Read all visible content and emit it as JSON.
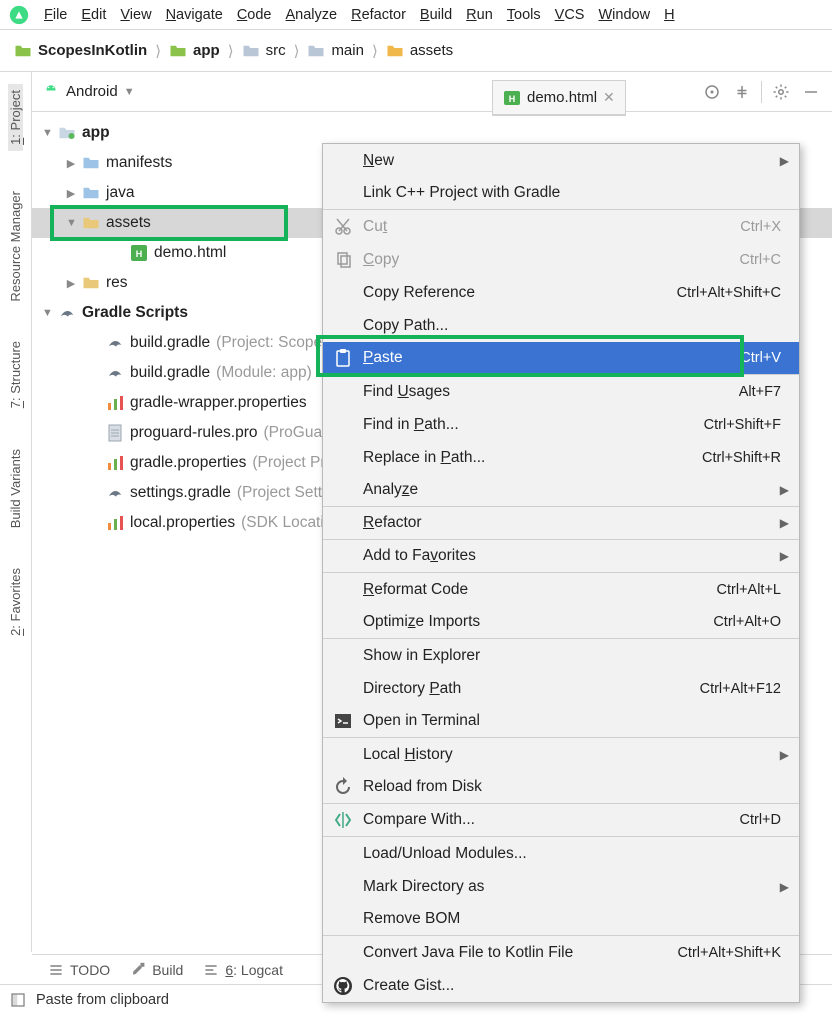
{
  "menubar": [
    "File",
    "Edit",
    "View",
    "Navigate",
    "Code",
    "Analyze",
    "Refactor",
    "Build",
    "Run",
    "Tools",
    "VCS",
    "Window",
    "H"
  ],
  "breadcrumbs": [
    {
      "label": "ScopesInKotlin",
      "bold": true,
      "icon": "project"
    },
    {
      "label": "app",
      "bold": true,
      "icon": "module"
    },
    {
      "label": "src",
      "bold": false,
      "icon": "folder"
    },
    {
      "label": "main",
      "bold": false,
      "icon": "folder"
    },
    {
      "label": "assets",
      "bold": false,
      "icon": "assets"
    }
  ],
  "panel": {
    "mode": "Android",
    "tree": [
      {
        "level": 0,
        "arrow": "down",
        "icon": "module",
        "label": "app",
        "sub": "",
        "selected": false
      },
      {
        "level": 1,
        "arrow": "right",
        "icon": "folder",
        "label": "manifests",
        "sub": "",
        "selected": false
      },
      {
        "level": 1,
        "arrow": "right",
        "icon": "folder",
        "label": "java",
        "sub": "",
        "selected": false
      },
      {
        "level": 1,
        "arrow": "down",
        "icon": "assets",
        "label": "assets",
        "sub": "",
        "selected": true
      },
      {
        "level": 3,
        "arrow": "",
        "icon": "html",
        "label": "demo.html",
        "sub": "",
        "selected": false
      },
      {
        "level": 1,
        "arrow": "right",
        "icon": "res",
        "label": "res",
        "sub": "",
        "selected": false
      },
      {
        "level": 0,
        "arrow": "down",
        "icon": "gradle",
        "label": "Gradle Scripts",
        "sub": "",
        "selected": false
      },
      {
        "level": 2,
        "arrow": "",
        "icon": "gradle",
        "label": "build.gradle ",
        "sub": "(Project: ScopesInKotlin)",
        "selected": false
      },
      {
        "level": 2,
        "arrow": "",
        "icon": "gradle",
        "label": "build.gradle ",
        "sub": "(Module: app)",
        "selected": false
      },
      {
        "level": 2,
        "arrow": "",
        "icon": "props",
        "label": "gradle-wrapper.properties ",
        "sub": "",
        "selected": false
      },
      {
        "level": 2,
        "arrow": "",
        "icon": "file",
        "label": "proguard-rules.pro ",
        "sub": "(ProGuard)",
        "selected": false
      },
      {
        "level": 2,
        "arrow": "",
        "icon": "props",
        "label": "gradle.properties ",
        "sub": "(Project Properties)",
        "selected": false
      },
      {
        "level": 2,
        "arrow": "",
        "icon": "gradle",
        "label": "settings.gradle ",
        "sub": "(Project Settings)",
        "selected": false
      },
      {
        "level": 2,
        "arrow": "",
        "icon": "props",
        "label": "local.properties ",
        "sub": "(SDK Location)",
        "selected": false
      }
    ]
  },
  "editor_tab": {
    "label": "demo.html"
  },
  "gutter": [
    {
      "label": "1: Project",
      "icon": "project",
      "active": true
    },
    {
      "label": "Resource Manager",
      "icon": "resource",
      "active": false
    },
    {
      "label": "7: Structure",
      "icon": "structure",
      "active": false
    },
    {
      "label": "Build Variants",
      "icon": "variants",
      "active": false
    },
    {
      "label": "2: Favorites",
      "icon": "star",
      "active": false
    }
  ],
  "context_menu": [
    {
      "icon": "",
      "label": "New",
      "shortcut": "",
      "expand": true,
      "sep": false,
      "key": "N"
    },
    {
      "icon": "",
      "label": "Link C++ Project with Gradle",
      "shortcut": "",
      "expand": false,
      "sep": true,
      "key": ""
    },
    {
      "icon": "cut",
      "label": "Cut",
      "shortcut": "Ctrl+X",
      "expand": false,
      "sep": false,
      "disabled": true,
      "key": "t"
    },
    {
      "icon": "copy",
      "label": "Copy",
      "shortcut": "Ctrl+C",
      "expand": false,
      "sep": false,
      "disabled": true,
      "key": "C"
    },
    {
      "icon": "",
      "label": "Copy Reference",
      "shortcut": "Ctrl+Alt+Shift+C",
      "expand": false,
      "sep": false,
      "key": ""
    },
    {
      "icon": "",
      "label": "Copy Path...",
      "shortcut": "",
      "expand": false,
      "sep": false,
      "key": ""
    },
    {
      "icon": "paste",
      "label": "Paste",
      "shortcut": "Ctrl+V",
      "expand": false,
      "sep": true,
      "highlight": true,
      "key": "P"
    },
    {
      "icon": "",
      "label": "Find Usages",
      "shortcut": "Alt+F7",
      "expand": false,
      "sep": false,
      "key": "U"
    },
    {
      "icon": "",
      "label": "Find in Path...",
      "shortcut": "Ctrl+Shift+F",
      "expand": false,
      "sep": false,
      "key": "P"
    },
    {
      "icon": "",
      "label": "Replace in Path...",
      "shortcut": "Ctrl+Shift+R",
      "expand": false,
      "sep": false,
      "key": "P"
    },
    {
      "icon": "",
      "label": "Analyze",
      "shortcut": "",
      "expand": true,
      "sep": true,
      "key": "z"
    },
    {
      "icon": "",
      "label": "Refactor",
      "shortcut": "",
      "expand": true,
      "sep": true,
      "key": "R"
    },
    {
      "icon": "",
      "label": "Add to Favorites",
      "shortcut": "",
      "expand": true,
      "sep": true,
      "key": "v"
    },
    {
      "icon": "",
      "label": "Reformat Code",
      "shortcut": "Ctrl+Alt+L",
      "expand": false,
      "sep": false,
      "key": "R"
    },
    {
      "icon": "",
      "label": "Optimize Imports",
      "shortcut": "Ctrl+Alt+O",
      "expand": false,
      "sep": true,
      "key": "z"
    },
    {
      "icon": "",
      "label": "Show in Explorer",
      "shortcut": "",
      "expand": false,
      "sep": false,
      "key": ""
    },
    {
      "icon": "",
      "label": "Directory Path",
      "shortcut": "Ctrl+Alt+F12",
      "expand": false,
      "sep": false,
      "key": "P"
    },
    {
      "icon": "terminal",
      "label": "Open in Terminal",
      "shortcut": "",
      "expand": false,
      "sep": true,
      "key": ""
    },
    {
      "icon": "",
      "label": "Local History",
      "shortcut": "",
      "expand": true,
      "sep": false,
      "key": "H"
    },
    {
      "icon": "reload",
      "label": "Reload from Disk",
      "shortcut": "",
      "expand": false,
      "sep": true,
      "key": ""
    },
    {
      "icon": "compare",
      "label": "Compare With...",
      "shortcut": "Ctrl+D",
      "expand": false,
      "sep": true,
      "key": ""
    },
    {
      "icon": "",
      "label": "Load/Unload Modules...",
      "shortcut": "",
      "expand": false,
      "sep": false,
      "key": ""
    },
    {
      "icon": "",
      "label": "Mark Directory as",
      "shortcut": "",
      "expand": true,
      "sep": false,
      "key": ""
    },
    {
      "icon": "",
      "label": "Remove BOM",
      "shortcut": "",
      "expand": false,
      "sep": true,
      "key": ""
    },
    {
      "icon": "",
      "label": "Convert Java File to Kotlin File",
      "shortcut": "Ctrl+Alt+Shift+K",
      "expand": false,
      "sep": false,
      "key": ""
    },
    {
      "icon": "github",
      "label": "Create Gist...",
      "shortcut": "",
      "expand": false,
      "sep": false,
      "key": ""
    }
  ],
  "bottom_tabs": [
    {
      "icon": "todo",
      "label": "TODO"
    },
    {
      "icon": "hammer",
      "label": "Build"
    },
    {
      "icon": "logcat",
      "label": "6: Logcat"
    }
  ],
  "statusbar": {
    "text": "Paste from clipboard"
  }
}
